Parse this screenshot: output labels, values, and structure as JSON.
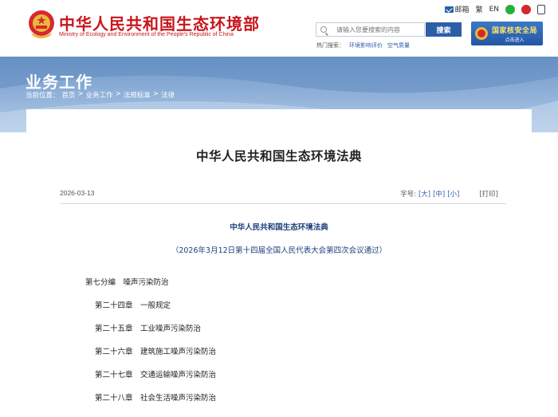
{
  "header": {
    "site_title": "中华人民共和国生态环境部",
    "site_subtitle": "Ministry of Ecology and Environment of the People's Republic of China",
    "top_links": {
      "mail": "邮箱",
      "traditional": "繁",
      "english": "EN"
    },
    "search": {
      "placeholder": "请输入您要搜索的内容",
      "button_label": "搜索",
      "hot_label": "热门搜索：",
      "hot_terms": [
        "环境影响评价",
        "空气质量"
      ]
    },
    "nuclear_banner": {
      "title": "国家核安全局",
      "subtitle": "点击进入"
    },
    "icons": [
      "mail-icon",
      "wechat-icon",
      "weibo-icon",
      "app-icon"
    ],
    "colors": {
      "brand_red": "#c8161d",
      "brand_blue": "#2c5ea8"
    }
  },
  "banner": {
    "section_title": "业务工作",
    "breadcrumb": {
      "prefix": "当前位置：",
      "items": [
        "首页",
        "业务工作",
        "法规标准",
        "法律"
      ],
      "separator": ">"
    }
  },
  "article": {
    "title": "中华人民共和国生态环境法典",
    "date": "2026-03-13",
    "font_size_label": "字号:",
    "font_sizes": [
      "[大]",
      "[中]",
      "[小]"
    ],
    "print_label": "[打印]",
    "law_heading": "中华人民共和国生态环境法典",
    "law_note": "（2026年3月12日第十四届全国人民代表大会第四次会议通过）",
    "toc": [
      {
        "text": "第七分编　噪声污染防治",
        "level": "part"
      },
      {
        "text": "第二十四章　一般规定",
        "level": "chapter"
      },
      {
        "text": "第二十五章　工业噪声污染防治",
        "level": "chapter"
      },
      {
        "text": "第二十六章　建筑施工噪声污染防治",
        "level": "chapter"
      },
      {
        "text": "第二十七章　交通运输噪声污染防治",
        "level": "chapter"
      },
      {
        "text": "第二十八章　社会生活噪声污染防治",
        "level": "chapter"
      }
    ]
  }
}
